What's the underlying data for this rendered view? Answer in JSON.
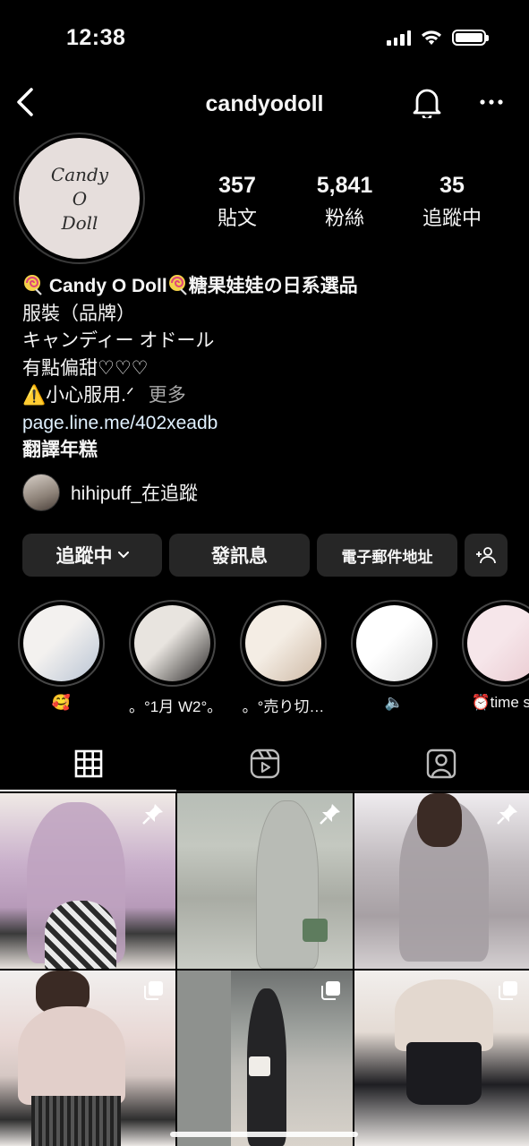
{
  "status_bar": {
    "time": "12:38"
  },
  "nav": {
    "username": "candyodoll"
  },
  "profile": {
    "avatar_text": [
      "Candy",
      "O",
      "Doll"
    ],
    "stats": [
      {
        "value": "357",
        "label": "貼文"
      },
      {
        "value": "5,841",
        "label": "粉絲"
      },
      {
        "value": "35",
        "label": "追蹤中"
      }
    ]
  },
  "bio": {
    "name": " Candy O Doll",
    "name_suffix": "糖果娃娃の日系選品",
    "category": "服裝（品牌）",
    "line1": "キャンディー オドール",
    "line2": "有點偏甜♡♡♡",
    "line3": "⚠️小心服用.ᐟ",
    "more": "更多",
    "link": "page.line.me/402xeadb",
    "translate": "翻譯年糕"
  },
  "followed_by": {
    "text": "hihipuff_在追蹤"
  },
  "actions": {
    "following_label": "追蹤中",
    "message_label": "發訊息",
    "email_label": "電子郵件地址"
  },
  "highlights": [
    {
      "label": "🥰",
      "color_a": "#f3f1ef",
      "color_b": "#b9c4d4"
    },
    {
      "label": "。°1月 W2°。",
      "color_a": "#e8e4df",
      "color_b": "#2d2b2a"
    },
    {
      "label": "。°売り切…",
      "color_a": "#f4ede4",
      "color_b": "#cdb8a4"
    },
    {
      "label": "🔈",
      "color_a": "#ffffff",
      "color_b": "#dcdcdc"
    },
    {
      "label": "⏰time sa",
      "color_a": "#f6e6ea",
      "color_b": "#e9c9cf"
    }
  ],
  "tabs": [
    {
      "name": "grid-icon"
    },
    {
      "name": "reels-icon"
    },
    {
      "name": "tagged-icon"
    }
  ],
  "posts": [
    {
      "badge": "pin-icon"
    },
    {
      "badge": "pin-icon"
    },
    {
      "badge": "pin-icon"
    },
    {
      "badge": "carousel-icon"
    },
    {
      "badge": "carousel-icon"
    },
    {
      "badge": "carousel-icon"
    }
  ]
}
